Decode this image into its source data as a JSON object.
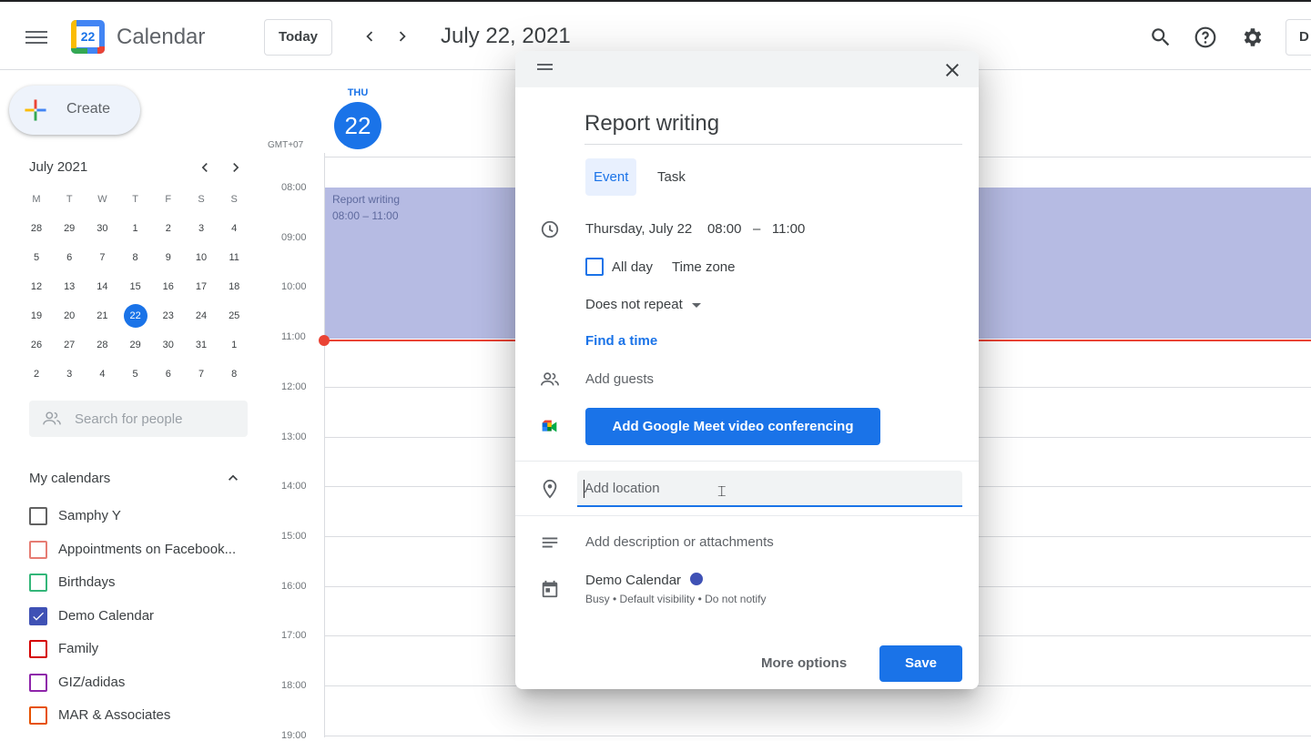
{
  "header": {
    "app_name": "Calendar",
    "logo_number": "22",
    "today_label": "Today",
    "date_title": "July 22, 2021",
    "account_initial": "D"
  },
  "sidebar": {
    "create_label": "Create",
    "mini_month": "July 2021",
    "weekdays": [
      "M",
      "T",
      "W",
      "T",
      "F",
      "S",
      "S"
    ],
    "weeks": [
      [
        "28",
        "29",
        "30",
        "1",
        "2",
        "3",
        "4"
      ],
      [
        "5",
        "6",
        "7",
        "8",
        "9",
        "10",
        "11"
      ],
      [
        "12",
        "13",
        "14",
        "15",
        "16",
        "17",
        "18"
      ],
      [
        "19",
        "20",
        "21",
        "22",
        "23",
        "24",
        "25"
      ],
      [
        "26",
        "27",
        "28",
        "29",
        "30",
        "31",
        "1"
      ],
      [
        "2",
        "3",
        "4",
        "5",
        "6",
        "7",
        "8"
      ]
    ],
    "selected_day": "22",
    "search_people_placeholder": "Search for people",
    "my_calendars_title": "My calendars",
    "calendars": [
      {
        "name": "Samphy Y",
        "color": "#616161",
        "checked": false
      },
      {
        "name": "Appointments on Facebook...",
        "color": "#e67c73",
        "checked": false
      },
      {
        "name": "Birthdays",
        "color": "#33b679",
        "checked": false
      },
      {
        "name": "Demo Calendar",
        "color": "#3f51b5",
        "checked": true
      },
      {
        "name": "Family",
        "color": "#d50000",
        "checked": false
      },
      {
        "name": "GIZ/adidas",
        "color": "#8e24aa",
        "checked": false
      },
      {
        "name": "MAR & Associates",
        "color": "#e65100",
        "checked": false
      }
    ]
  },
  "day_view": {
    "day_of_week": "THU",
    "day_number": "22",
    "timezone": "GMT+07",
    "hours": [
      "08:00",
      "09:00",
      "10:00",
      "11:00",
      "12:00",
      "13:00",
      "14:00",
      "15:00",
      "16:00",
      "17:00",
      "18:00",
      "19:00"
    ],
    "event": {
      "title": "Report writing",
      "time": "08:00 – 11:00",
      "color": "#b6bbe3"
    }
  },
  "dialog": {
    "title": "Report writing",
    "tabs": [
      "Event",
      "Task"
    ],
    "active_tab": "Event",
    "date": "Thursday, July 22",
    "start": "08:00",
    "dash": "–",
    "end": "11:00",
    "all_day_label": "All day",
    "time_zone_label": "Time zone",
    "repeat_label": "Does not repeat",
    "find_time_label": "Find a time",
    "guests_placeholder": "Add guests",
    "meet_button": "Add Google Meet video conferencing",
    "location_placeholder": "Add location",
    "description_placeholder": "Add description or attachments",
    "calendar_name": "Demo Calendar",
    "calendar_color": "#3f51b5",
    "calendar_details": "Busy • Default visibility • Do not notify",
    "more_options_label": "More options",
    "save_label": "Save"
  },
  "colors": {
    "accent": "#1a73e8",
    "now_line": "#ea4335"
  }
}
